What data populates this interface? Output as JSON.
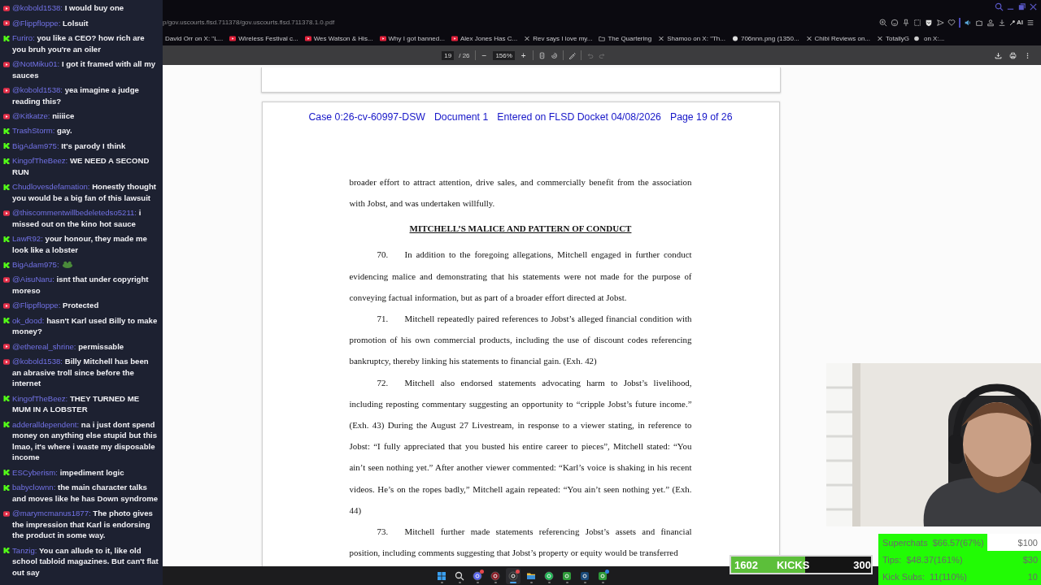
{
  "chat": {
    "messages": [
      {
        "kind": "youtube",
        "user": "@kobold1538:",
        "text": "I would buy one"
      },
      {
        "kind": "youtube",
        "user": "@Flippfloppe:",
        "text": "Lolsuit"
      },
      {
        "kind": "kick",
        "user": "Furiro:",
        "text": "you like a CEO? how rich are you bruh you're an oiler"
      },
      {
        "kind": "youtube",
        "user": "@NotMiku01:",
        "text": "I got it framed with all my sauces"
      },
      {
        "kind": "youtube",
        "user": "@kobold1538:",
        "text": "yea imagine a judge reading this?"
      },
      {
        "kind": "youtube",
        "user": "@Kitkatze:",
        "text": "niiiice"
      },
      {
        "kind": "kick",
        "user": "TrashStorm:",
        "text": "gay."
      },
      {
        "kind": "kick",
        "user": "BigAdam975:",
        "text": "It's parody I think"
      },
      {
        "kind": "kick",
        "user": "KingofTheBeez:",
        "text": "WE NEED A SECOND RUN"
      },
      {
        "kind": "kick",
        "user": "Chudlovesdefamation:",
        "text": "Honestly thought you would be a big fan of this lawsuit"
      },
      {
        "kind": "youtube",
        "user": "@thiscommentwillbedeletedso5211:",
        "text": "i missed out on the kino hot sauce"
      },
      {
        "kind": "kick",
        "user": "LawR92:",
        "text": "your honour, they made me look like a lobster"
      },
      {
        "kind": "kick",
        "user": "BigAdam975:",
        "emote": true
      },
      {
        "kind": "youtube",
        "user": "@AisuNaru:",
        "text": "isnt that under copyright moreso"
      },
      {
        "kind": "youtube",
        "user": "@Flippfloppe:",
        "text": "Protected"
      },
      {
        "kind": "kick",
        "user": "ok_dood:",
        "text": "hasn't Karl used Billy to make money?"
      },
      {
        "kind": "youtube",
        "user": "@ethereal_shrine:",
        "text": "permissable"
      },
      {
        "kind": "youtube",
        "user": "@kobold1538:",
        "text": "Billy Mitchell has been an abrasive troll since before the internet"
      },
      {
        "kind": "kick",
        "user": "KingofTheBeez:",
        "text": "THEY TURNED ME MUM IN A LOBSTER"
      },
      {
        "kind": "kick",
        "user": "adderalldependent:",
        "text": "na i just dont spend money on anything else stupid but this lmao, it's where i waste my disposable income"
      },
      {
        "kind": "kick",
        "user": "ESCyberism:",
        "text": "impediment logic"
      },
      {
        "kind": "kick",
        "user": "babyclownn:",
        "text": "the main character talks and moves like he has Down syndrome"
      },
      {
        "kind": "youtube",
        "user": "@marymcmanus1877:",
        "text": "The photo gives the impression that Karl is endorsing the product in some way."
      },
      {
        "kind": "kick",
        "user": "Tanzig:",
        "text": "You can allude to it, like old school tabloid magazines. But can't flat out say"
      }
    ]
  },
  "browser": {
    "url": "p/gov.uscourts.flsd.711378/gov.uscourts.flsd.711378.1.0.pdf",
    "toolbar_label": "AI",
    "bookmarks": [
      {
        "kind": "plain",
        "label": "David Orr on X: \"L..."
      },
      {
        "kind": "video",
        "label": "Wireless Festival c..."
      },
      {
        "kind": "video",
        "label": "Wes Watson & His..."
      },
      {
        "kind": "video",
        "label": "Why I got banned..."
      },
      {
        "kind": "video",
        "label": "Alex Jones Has C..."
      },
      {
        "kind": "post",
        "label": "Rev says I love my..."
      },
      {
        "kind": "folder",
        "label": "The Quartering"
      },
      {
        "kind": "post",
        "label": "Shamoo on X: \"Th..."
      },
      {
        "label": "706nnn.png (1350..."
      },
      {
        "kind": "post",
        "label": "Chibi Reviews on..."
      },
      {
        "kind": "post",
        "label": "TotallyG",
        "suffix": "on X:..."
      }
    ]
  },
  "pdf_toolbar": {
    "page": "19",
    "total": "/ 26",
    "zoom": "156%",
    "minus": "−",
    "plus": "+"
  },
  "document": {
    "header": [
      "Case 0:26-cv-60997-DSW",
      "Document 1",
      "Entered on FLSD Docket 04/08/2026",
      "Page 19 of 26"
    ],
    "intro": "broader effort to attract attention, drive sales, and commercially benefit from the association with Jobst, and was undertaken willfully.",
    "heading": "MITCHELL’S MALICE AND PATTERN OF CONDUCT",
    "paragraphs": [
      {
        "number": "70.",
        "text": "In addition to the foregoing allegations, Mitchell engaged in further conduct evidencing malice and demonstrating that his statements were not made for the purpose of conveying factual information, but as part of a broader effort directed at Jobst."
      },
      {
        "number": "71.",
        "text": "Mitchell repeatedly paired references to Jobst’s alleged financial condition with promotion of his own commercial products, including the use of discount codes referencing bankruptcy, thereby linking his statements to financial gain. (Exh. 42)"
      },
      {
        "number": "72.",
        "text": "Mitchell also endorsed statements advocating harm to Jobst’s livelihood, including reposting commentary suggesting an opportunity to “cripple Jobst’s future income.” (Exh. 43) During the August 27 Livestream, in response to a viewer stating, in reference to Jobst: “I fully appreciated that you busted his entire career to pieces”, Mitchell stated: “You ain’t seen nothing yet.” After another viewer commented: “Karl’s voice is shaking in his recent videos. He’s on the ropes badly,” Mitchell again repeated: “You ain’t seen nothing yet.” (Exh. 44)"
      },
      {
        "number": "73.",
        "text": "Mitchell further made statements referencing Jobst’s assets and financial position, including comments suggesting that Jobst’s property or equity would be transferred"
      }
    ]
  },
  "stream_overlay": {
    "kicks": {
      "count": "1602",
      "label": "KICKS",
      "goal": "300",
      "level": 0.53
    },
    "goals": [
      {
        "label": "Superchats",
        "amount": "$66.57(67%)",
        "target": "$100",
        "level": 0.67
      },
      {
        "label": "Tips:",
        "amount": "$48.37(161%)",
        "target": "$30",
        "level": 1
      },
      {
        "label": "Kick Subs:",
        "amount": "11(110%)",
        "target": "10",
        "level": 1
      }
    ]
  },
  "taskbar": {
    "apps": [
      {
        "kind": "start",
        "selected": false
      },
      {
        "kind": "search",
        "selected": false
      },
      {
        "kind": "chat",
        "selected": false,
        "badge": {
          "color": "#e5484d"
        }
      },
      {
        "kind": "ring",
        "selected": false
      },
      {
        "kind": "record",
        "selected": true,
        "badge": {
          "color": "#e5484d"
        }
      },
      {
        "kind": "folder",
        "selected": false
      },
      {
        "kind": "music",
        "selected": false
      },
      {
        "kind": "game",
        "selected": false
      },
      {
        "kind": "steam",
        "selected": false
      },
      {
        "kind": "game",
        "selected": false,
        "badge": {
          "color": "#2f7fe0"
        }
      }
    ]
  }
}
